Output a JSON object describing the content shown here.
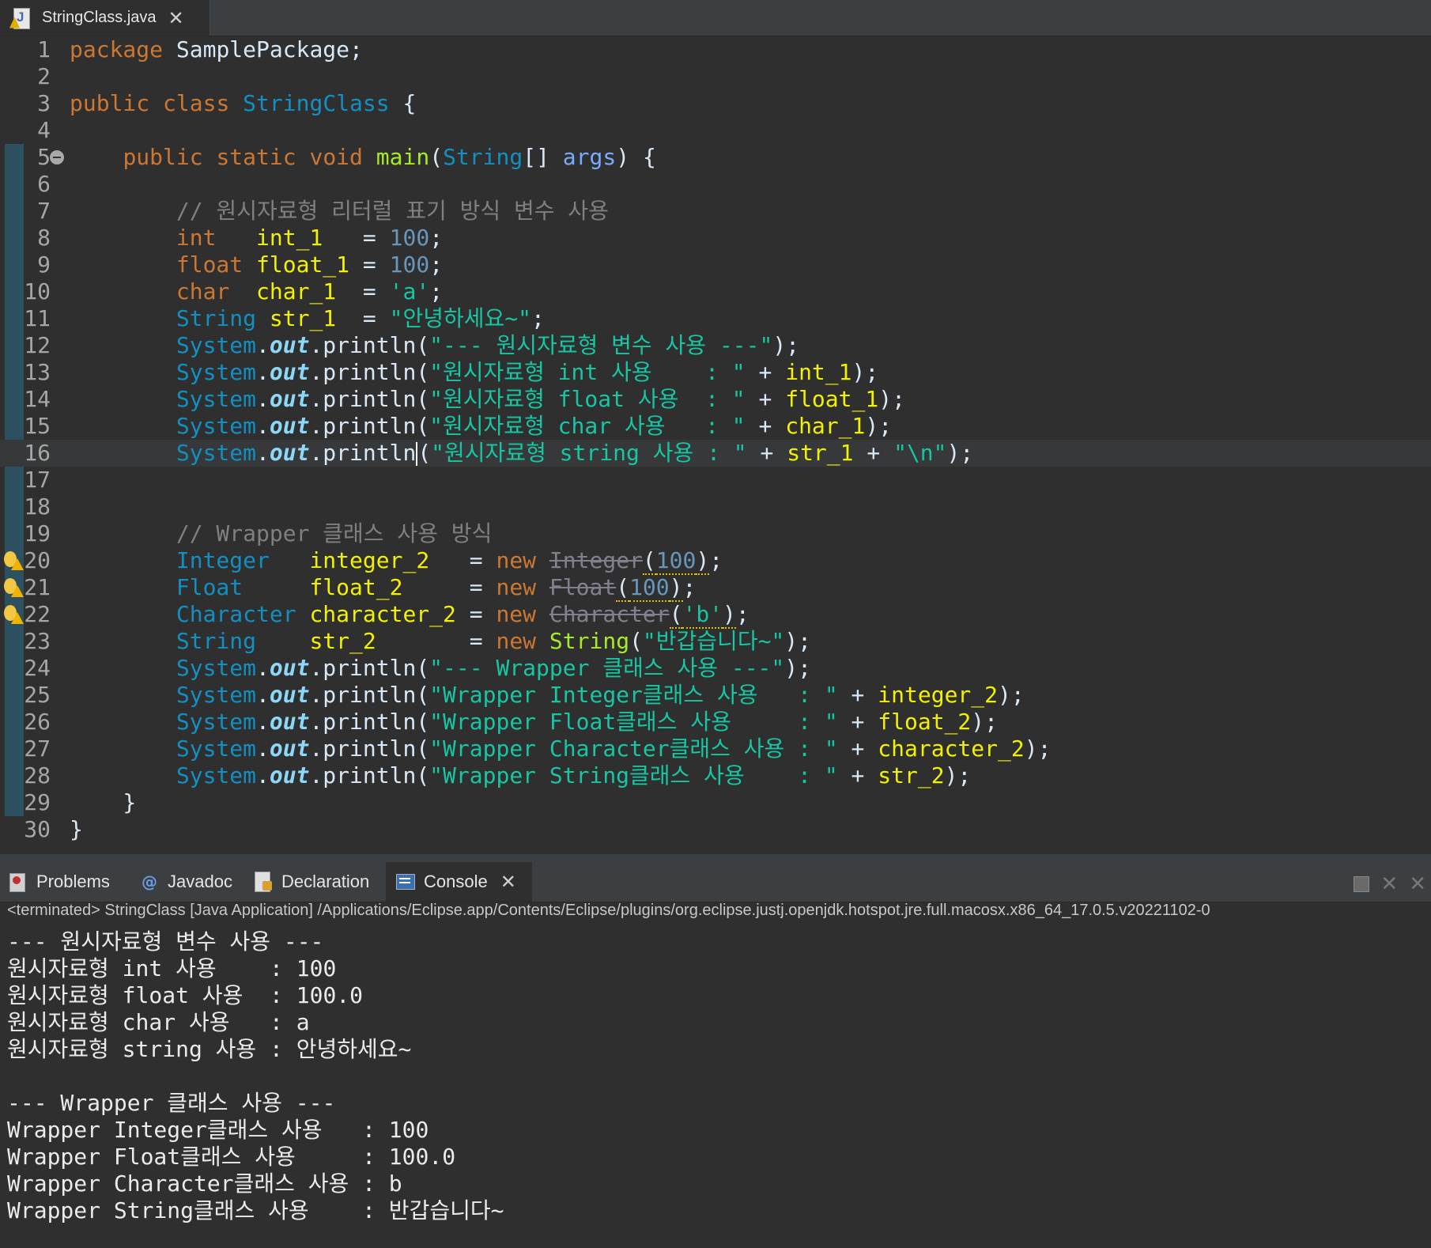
{
  "editor_tab": {
    "title": "StringClass.java",
    "icon": "java-file-icon",
    "close": "✕"
  },
  "code": [
    {
      "n": "1",
      "segs": [
        [
          "kw",
          "package"
        ],
        [
          "tx",
          " SamplePackage;"
        ]
      ]
    },
    {
      "n": "2",
      "segs": []
    },
    {
      "n": "3",
      "segs": [
        [
          "kw",
          "public"
        ],
        [
          "tx",
          " "
        ],
        [
          "kw",
          "class"
        ],
        [
          "tx",
          " "
        ],
        [
          "cls",
          "StringClass"
        ],
        [
          "tx",
          " {"
        ]
      ]
    },
    {
      "n": "4",
      "segs": []
    },
    {
      "n": "5",
      "fold": true,
      "segs": [
        [
          "tx",
          "    "
        ],
        [
          "kw",
          "public"
        ],
        [
          "tx",
          " "
        ],
        [
          "kw",
          "static"
        ],
        [
          "tx",
          " "
        ],
        [
          "kw",
          "void"
        ],
        [
          "tx",
          " "
        ],
        [
          "fn",
          "main"
        ],
        [
          "tx",
          "("
        ],
        [
          "cls",
          "String"
        ],
        [
          "tx",
          "[] "
        ],
        [
          "pm",
          "args"
        ],
        [
          "tx",
          ") {"
        ]
      ]
    },
    {
      "n": "6",
      "segs": []
    },
    {
      "n": "7",
      "segs": [
        [
          "tx",
          "        "
        ],
        [
          "cm",
          "// 원시자료형 리터럴 표기 방식 변수 사용"
        ]
      ]
    },
    {
      "n": "8",
      "segs": [
        [
          "tx",
          "        "
        ],
        [
          "kw",
          "int"
        ],
        [
          "tx",
          "   "
        ],
        [
          "vr",
          "int_1"
        ],
        [
          "tx",
          "   = "
        ],
        [
          "nu",
          "100"
        ],
        [
          "tx",
          ";"
        ]
      ]
    },
    {
      "n": "9",
      "segs": [
        [
          "tx",
          "        "
        ],
        [
          "kw",
          "float"
        ],
        [
          "tx",
          " "
        ],
        [
          "vr",
          "float_1"
        ],
        [
          "tx",
          " = "
        ],
        [
          "nu",
          "100"
        ],
        [
          "tx",
          ";"
        ]
      ]
    },
    {
      "n": "10",
      "segs": [
        [
          "tx",
          "        "
        ],
        [
          "kw",
          "char"
        ],
        [
          "tx",
          "  "
        ],
        [
          "vr",
          "char_1"
        ],
        [
          "tx",
          "  = "
        ],
        [
          "st",
          "'a'"
        ],
        [
          "tx",
          ";"
        ]
      ]
    },
    {
      "n": "11",
      "segs": [
        [
          "tx",
          "        "
        ],
        [
          "cls",
          "String"
        ],
        [
          "tx",
          " "
        ],
        [
          "vr",
          "str_1"
        ],
        [
          "tx",
          "  = "
        ],
        [
          "st",
          "\"안녕하세요~\""
        ],
        [
          "tx",
          ";"
        ]
      ]
    },
    {
      "n": "12",
      "segs": [
        [
          "tx",
          "        "
        ],
        [
          "cls",
          "System"
        ],
        [
          "tx",
          "."
        ],
        [
          "fd",
          "out"
        ],
        [
          "tx",
          ".println("
        ],
        [
          "st",
          "\"--- 원시자료형 변수 사용 ---\""
        ],
        [
          "tx",
          ");"
        ]
      ]
    },
    {
      "n": "13",
      "segs": [
        [
          "tx",
          "        "
        ],
        [
          "cls",
          "System"
        ],
        [
          "tx",
          "."
        ],
        [
          "fd",
          "out"
        ],
        [
          "tx",
          ".println("
        ],
        [
          "st",
          "\"원시자료형 int 사용    : \""
        ],
        [
          "tx",
          " + "
        ],
        [
          "vr",
          "int_1"
        ],
        [
          "tx",
          ");"
        ]
      ]
    },
    {
      "n": "14",
      "segs": [
        [
          "tx",
          "        "
        ],
        [
          "cls",
          "System"
        ],
        [
          "tx",
          "."
        ],
        [
          "fd",
          "out"
        ],
        [
          "tx",
          ".println("
        ],
        [
          "st",
          "\"원시자료형 float 사용  : \""
        ],
        [
          "tx",
          " + "
        ],
        [
          "vr",
          "float_1"
        ],
        [
          "tx",
          ");"
        ]
      ]
    },
    {
      "n": "15",
      "segs": [
        [
          "tx",
          "        "
        ],
        [
          "cls",
          "System"
        ],
        [
          "tx",
          "."
        ],
        [
          "fd",
          "out"
        ],
        [
          "tx",
          ".println("
        ],
        [
          "st",
          "\"원시자료형 char 사용   : \""
        ],
        [
          "tx",
          " + "
        ],
        [
          "vr",
          "char_1"
        ],
        [
          "tx",
          ");"
        ]
      ]
    },
    {
      "n": "16",
      "current": true,
      "segs": [
        [
          "tx",
          "        "
        ],
        [
          "cls",
          "System"
        ],
        [
          "tx",
          "."
        ],
        [
          "fd",
          "out"
        ],
        [
          "tx",
          ".println"
        ],
        [
          "cursor",
          ""
        ],
        [
          "tx",
          "("
        ],
        [
          "st",
          "\"원시자료형 string 사용 : \""
        ],
        [
          "tx",
          " + "
        ],
        [
          "vr",
          "str_1"
        ],
        [
          "tx",
          " + "
        ],
        [
          "st",
          "\"\\n\""
        ],
        [
          "tx",
          ");"
        ]
      ]
    },
    {
      "n": "17",
      "segs": []
    },
    {
      "n": "18",
      "segs": []
    },
    {
      "n": "19",
      "segs": [
        [
          "tx",
          "        "
        ],
        [
          "cm",
          "// Wrapper 클래스 사용 방식"
        ]
      ]
    },
    {
      "n": "20",
      "warn": true,
      "segs": [
        [
          "tx",
          "        "
        ],
        [
          "cls",
          "Integer"
        ],
        [
          "tx",
          "   "
        ],
        [
          "vr",
          "integer_2"
        ],
        [
          "tx",
          "   = "
        ],
        [
          "kw",
          "new"
        ],
        [
          "tx",
          " "
        ],
        [
          "dep",
          "Integer"
        ],
        [
          "wu",
          "("
        ],
        [
          "wun",
          "100"
        ],
        [
          "wu",
          ")"
        ],
        [
          "tx",
          ";"
        ]
      ]
    },
    {
      "n": "21",
      "warn": true,
      "segs": [
        [
          "tx",
          "        "
        ],
        [
          "cls",
          "Float"
        ],
        [
          "tx",
          "     "
        ],
        [
          "vr",
          "float_2"
        ],
        [
          "tx",
          "     = "
        ],
        [
          "kw",
          "new"
        ],
        [
          "tx",
          " "
        ],
        [
          "dep",
          "Float"
        ],
        [
          "wu",
          "("
        ],
        [
          "wun",
          "100"
        ],
        [
          "wu",
          ")"
        ],
        [
          "tx",
          ";"
        ]
      ]
    },
    {
      "n": "22",
      "warn": true,
      "segs": [
        [
          "tx",
          "        "
        ],
        [
          "cls",
          "Character"
        ],
        [
          "tx",
          " "
        ],
        [
          "vr",
          "character_2"
        ],
        [
          "tx",
          " = "
        ],
        [
          "kw",
          "new"
        ],
        [
          "tx",
          " "
        ],
        [
          "dep",
          "Character"
        ],
        [
          "wu",
          "("
        ],
        [
          "wus",
          "'b'"
        ],
        [
          "wu",
          ")"
        ],
        [
          "tx",
          ";"
        ]
      ]
    },
    {
      "n": "23",
      "segs": [
        [
          "tx",
          "        "
        ],
        [
          "cls",
          "String"
        ],
        [
          "tx",
          "    "
        ],
        [
          "vr",
          "str_2"
        ],
        [
          "tx",
          "       = "
        ],
        [
          "kw",
          "new"
        ],
        [
          "tx",
          " "
        ],
        [
          "fn",
          "String"
        ],
        [
          "tx",
          "("
        ],
        [
          "st",
          "\"반갑습니다~\""
        ],
        [
          "tx",
          ");"
        ]
      ]
    },
    {
      "n": "24",
      "segs": [
        [
          "tx",
          "        "
        ],
        [
          "cls",
          "System"
        ],
        [
          "tx",
          "."
        ],
        [
          "fd",
          "out"
        ],
        [
          "tx",
          ".println("
        ],
        [
          "st",
          "\"--- Wrapper 클래스 사용 ---\""
        ],
        [
          "tx",
          ");"
        ]
      ]
    },
    {
      "n": "25",
      "segs": [
        [
          "tx",
          "        "
        ],
        [
          "cls",
          "System"
        ],
        [
          "tx",
          "."
        ],
        [
          "fd",
          "out"
        ],
        [
          "tx",
          ".println("
        ],
        [
          "st",
          "\"Wrapper Integer클래스 사용   : \""
        ],
        [
          "tx",
          " + "
        ],
        [
          "vr",
          "integer_2"
        ],
        [
          "tx",
          ");"
        ]
      ]
    },
    {
      "n": "26",
      "segs": [
        [
          "tx",
          "        "
        ],
        [
          "cls",
          "System"
        ],
        [
          "tx",
          "."
        ],
        [
          "fd",
          "out"
        ],
        [
          "tx",
          ".println("
        ],
        [
          "st",
          "\"Wrapper Float클래스 사용     : \""
        ],
        [
          "tx",
          " + "
        ],
        [
          "vr",
          "float_2"
        ],
        [
          "tx",
          ");"
        ]
      ]
    },
    {
      "n": "27",
      "segs": [
        [
          "tx",
          "        "
        ],
        [
          "cls",
          "System"
        ],
        [
          "tx",
          "."
        ],
        [
          "fd",
          "out"
        ],
        [
          "tx",
          ".println("
        ],
        [
          "st",
          "\"Wrapper Character클래스 사용 : \""
        ],
        [
          "tx",
          " + "
        ],
        [
          "vr",
          "character_2"
        ],
        [
          "tx",
          ");"
        ]
      ]
    },
    {
      "n": "28",
      "segs": [
        [
          "tx",
          "        "
        ],
        [
          "cls",
          "System"
        ],
        [
          "tx",
          "."
        ],
        [
          "fd",
          "out"
        ],
        [
          "tx",
          ".println("
        ],
        [
          "st",
          "\"Wrapper String클래스 사용    : \""
        ],
        [
          "tx",
          " + "
        ],
        [
          "vr",
          "str_2"
        ],
        [
          "tx",
          ");"
        ]
      ]
    },
    {
      "n": "29",
      "segs": [
        [
          "tx",
          "    }"
        ]
      ]
    },
    {
      "n": "30",
      "segs": [
        [
          "tx",
          "}"
        ]
      ]
    }
  ],
  "bottom_tabs": [
    {
      "label": "Problems",
      "icon": "problems-icon",
      "active": false
    },
    {
      "label": "Javadoc",
      "icon": "javadoc-icon",
      "active": false
    },
    {
      "label": "Declaration",
      "icon": "declaration-icon",
      "active": false
    },
    {
      "label": "Console",
      "icon": "console-icon",
      "active": true,
      "close": "✕"
    }
  ],
  "console": {
    "terminated": "<terminated> StringClass [Java Application] /Applications/Eclipse.app/Contents/Eclipse/plugins/org.eclipse.justj.openjdk.hotspot.jre.full.macosx.x86_64_17.0.5.v20221102-0",
    "output": [
      "--- 원시자료형 변수 사용 ---",
      "원시자료형 int 사용    : 100",
      "원시자료형 float 사용  : 100.0",
      "원시자료형 char 사용   : a",
      "원시자료형 string 사용 : 안녕하세요~",
      "",
      "--- Wrapper 클래스 사용 ---",
      "Wrapper Integer클래스 사용   : 100",
      "Wrapper Float클래스 사용     : 100.0",
      "Wrapper Character클래스 사용 : b",
      "Wrapper String클래스 사용    : 반갑습니다~"
    ]
  },
  "colors": {
    "editor_bg": "#2f2f2f",
    "keyword": "#cc7832",
    "class": "#1290c3",
    "variable": "#f2f200",
    "string": "#17c6a3",
    "number": "#6897bb",
    "comment": "#808080",
    "field": "#8dd8f8"
  },
  "view_actions": {
    "minimize": "minimize-icon",
    "close": "✕",
    "close_all": "✕"
  }
}
